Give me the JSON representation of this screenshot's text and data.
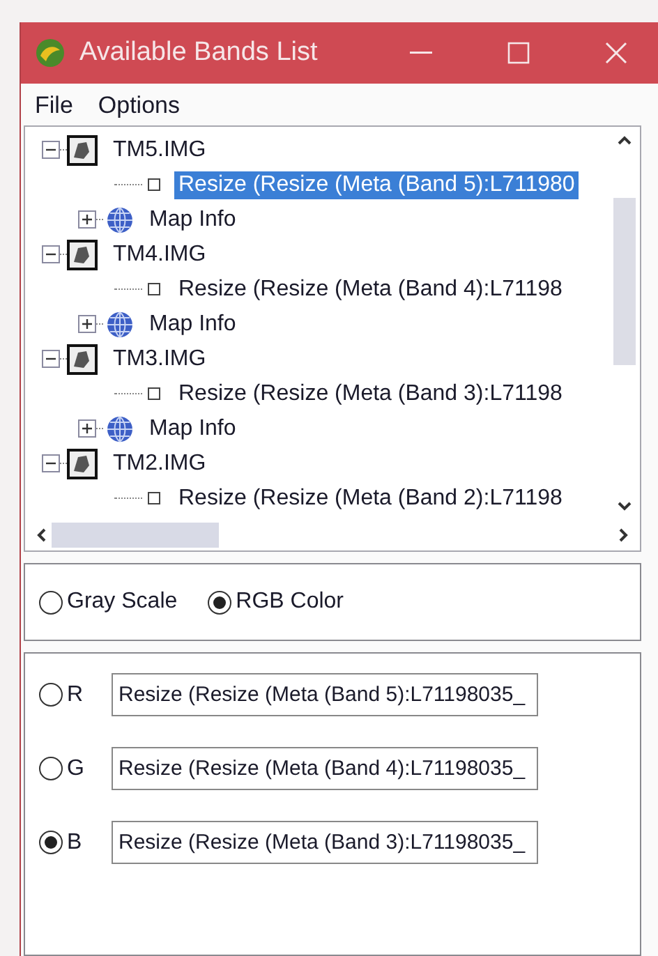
{
  "window": {
    "title": "Available Bands List"
  },
  "menu": [
    "File",
    "Options"
  ],
  "tree": [
    {
      "kind": "file",
      "label": "TM5.IMG",
      "expanded": true,
      "children": [
        {
          "kind": "band",
          "label": "Resize (Resize (Meta (Band 5):L711980",
          "selected": true
        },
        {
          "kind": "info",
          "label": "Map Info",
          "expanded": false
        }
      ]
    },
    {
      "kind": "file",
      "label": "TM4.IMG",
      "expanded": true,
      "children": [
        {
          "kind": "band",
          "label": "Resize (Resize (Meta (Band 4):L71198",
          "selected": false
        },
        {
          "kind": "info",
          "label": "Map Info",
          "expanded": false
        }
      ]
    },
    {
      "kind": "file",
      "label": "TM3.IMG",
      "expanded": true,
      "children": [
        {
          "kind": "band",
          "label": "Resize (Resize (Meta (Band 3):L71198",
          "selected": false
        },
        {
          "kind": "info",
          "label": "Map Info",
          "expanded": false
        }
      ]
    },
    {
      "kind": "file",
      "label": "TM2.IMG",
      "expanded": true,
      "children": [
        {
          "kind": "band",
          "label": "Resize (Resize (Meta (Band 2):L71198",
          "selected": false
        }
      ]
    }
  ],
  "display_mode": [
    {
      "label": "Gray Scale",
      "selected": false
    },
    {
      "label": "RGB Color",
      "selected": true
    }
  ],
  "channels": [
    {
      "label": "R",
      "selected": false,
      "value": "Resize (Resize (Meta (Band 5):L71198035_"
    },
    {
      "label": "G",
      "selected": false,
      "value": "Resize (Resize (Meta (Band 4):L71198035_"
    },
    {
      "label": "B",
      "selected": true,
      "value": "Resize (Resize (Meta (Band 3):L71198035_"
    }
  ]
}
